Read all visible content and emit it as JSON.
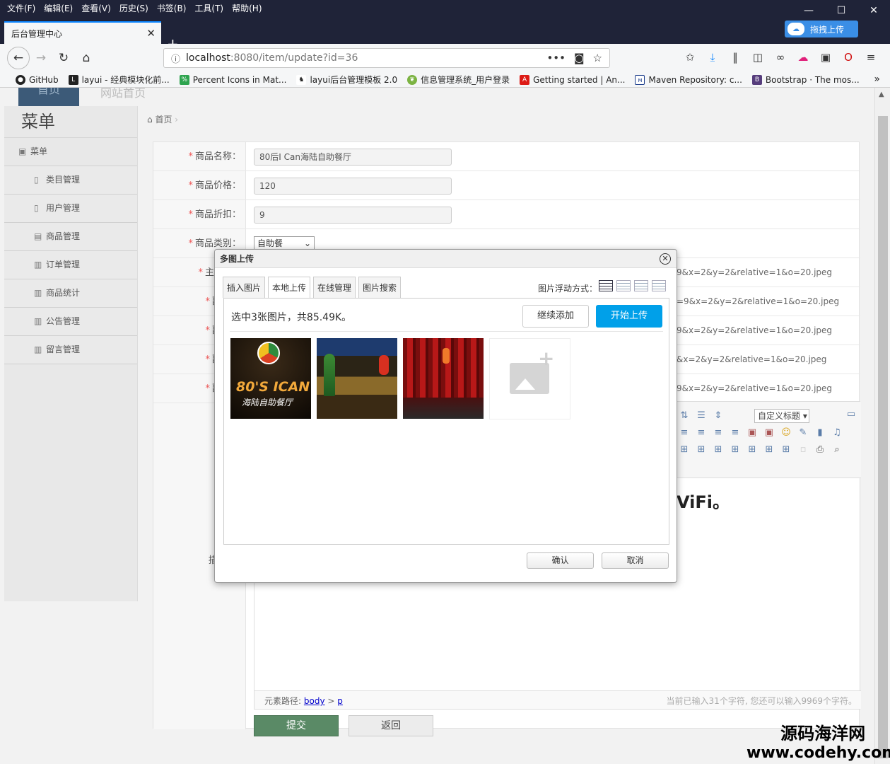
{
  "browser": {
    "menu": [
      "文件(F)",
      "编辑(E)",
      "查看(V)",
      "历史(S)",
      "书签(B)",
      "工具(T)",
      "帮助(H)"
    ],
    "tab_title": "后台管理中心",
    "url_host": "localhost",
    "url_rest": ":8080/item/update?id=36",
    "drag_upload": "拖拽上传",
    "bookmarks": [
      "GitHub",
      "layui - 经典模块化前...",
      "Percent Icons in Mat...",
      "layui后台管理模板 2.0",
      "信息管理系统_用户登录",
      "Getting started | An...",
      "Maven Repository: c...",
      "Bootstrap · The mos..."
    ]
  },
  "topnav": {
    "home": "首页",
    "site": "网站首页"
  },
  "sidebar": {
    "title": "菜单",
    "menu_label": "菜单",
    "items": [
      "类目管理",
      "用户管理",
      "商品管理",
      "订单管理",
      "商品统计",
      "公告管理",
      "留言管理"
    ]
  },
  "breadcrumb": "首页",
  "form": {
    "name_label": "商品名称：",
    "name_value": "80后I Can海陆自助餐厅",
    "price_label": "商品价格：",
    "price_value": "120",
    "discount_label": "商品折扣：",
    "discount_value": "9",
    "category_label": "商品类别：",
    "category_value": "自助餐",
    "main_label": "主",
    "sub_label": "副",
    "paths": [
      "9&x=2&y=2&relative=1&o=20.jpeg",
      "=9&x=2&y=2&relative=1&o=20.jpeg",
      "9&x=2&y=2&relative=1&o=20.jpeg",
      "&x=2&y=2&relative=1&o=20.jpeg",
      "9&x=2&y=2&relative=1&o=20.jpeg"
    ],
    "desc_label": "描",
    "heading_select": "自定义标题",
    "editor_text": "ViFi。",
    "element_path_label": "元素路径:",
    "element_path_body": "body",
    "element_path_sep": ">",
    "element_path_p": "p",
    "char_counter": "当前已输入31个字符, 您还可以输入9969个字符。",
    "submit": "提交",
    "back": "返回"
  },
  "dialog": {
    "title": "多图上传",
    "tabs": [
      "插入图片",
      "本地上传",
      "在线管理",
      "图片搜索"
    ],
    "active_tab": "本地上传",
    "float_label": "图片浮动方式：",
    "upload_info": "选中3张图片，共85.49K。",
    "add_more": "继续添加",
    "start_upload": "开始上传",
    "thumb1_brand": "80'S ICAN",
    "thumb1_sub": "海陆自助餐厅",
    "ok": "确认",
    "cancel": "取消"
  },
  "watermark": {
    "line1": "源码海洋网",
    "line2": "www.codehy.com"
  }
}
